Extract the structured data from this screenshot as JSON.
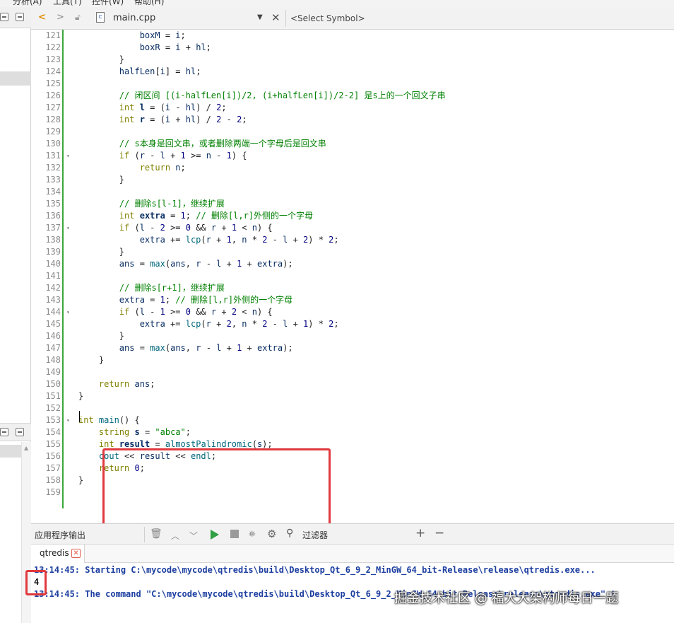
{
  "menu": {
    "items": [
      "分析(A)",
      "工具(T)",
      "控件(W)",
      "帮助(H)"
    ]
  },
  "editor_toolbar": {
    "file_name": "main.cpp",
    "symbol_select": "<Select Symbol>"
  },
  "code_lines": [
    {
      "n": "121",
      "fold": "",
      "t": "            boxM = i;"
    },
    {
      "n": "122",
      "fold": "",
      "t": "            boxR = i + hl;"
    },
    {
      "n": "123",
      "fold": "",
      "t": "        }"
    },
    {
      "n": "124",
      "fold": "",
      "t": "        halfLen[i] = hl;"
    },
    {
      "n": "125",
      "fold": "",
      "t": ""
    },
    {
      "n": "126",
      "fold": "",
      "t": "        // 闭区间 [(i-halfLen[i])/2, (i+halfLen[i])/2-2] 是s上的一个回文子串"
    },
    {
      "n": "127",
      "fold": "",
      "t": "        int l = (i - hl) / 2;"
    },
    {
      "n": "128",
      "fold": "",
      "t": "        int r = (i + hl) / 2 - 2;"
    },
    {
      "n": "129",
      "fold": "",
      "t": ""
    },
    {
      "n": "130",
      "fold": "",
      "t": "        // s本身是回文串，或者删除两端一个字母后是回文串"
    },
    {
      "n": "131",
      "fold": "▾",
      "t": "        if (r - l + 1 >= n - 1) {"
    },
    {
      "n": "132",
      "fold": "",
      "t": "            return n;"
    },
    {
      "n": "133",
      "fold": "",
      "t": "        }"
    },
    {
      "n": "134",
      "fold": "",
      "t": ""
    },
    {
      "n": "135",
      "fold": "",
      "t": "        // 删除s[l-1]，继续扩展"
    },
    {
      "n": "136",
      "fold": "",
      "t": "        int extra = 1; // 删除[l,r]外侧的一个字母"
    },
    {
      "n": "137",
      "fold": "▾",
      "t": "        if (l - 2 >= 0 && r + 1 < n) {"
    },
    {
      "n": "138",
      "fold": "",
      "t": "            extra += lcp(r + 1, n * 2 - l + 2) * 2;"
    },
    {
      "n": "139",
      "fold": "",
      "t": "        }"
    },
    {
      "n": "140",
      "fold": "",
      "t": "        ans = max(ans, r - l + 1 + extra);"
    },
    {
      "n": "141",
      "fold": "",
      "t": ""
    },
    {
      "n": "142",
      "fold": "",
      "t": "        // 删除s[r+1]，继续扩展"
    },
    {
      "n": "143",
      "fold": "",
      "t": "        extra = 1; // 删除[l,r]外侧的一个字母"
    },
    {
      "n": "144",
      "fold": "▾",
      "t": "        if (l - 1 >= 0 && r + 2 < n) {"
    },
    {
      "n": "145",
      "fold": "",
      "t": "            extra += lcp(r + 2, n * 2 - l + 1) * 2;"
    },
    {
      "n": "146",
      "fold": "",
      "t": "        }"
    },
    {
      "n": "147",
      "fold": "",
      "t": "        ans = max(ans, r - l + 1 + extra);"
    },
    {
      "n": "148",
      "fold": "",
      "t": "    }"
    },
    {
      "n": "149",
      "fold": "",
      "t": ""
    },
    {
      "n": "150",
      "fold": "",
      "t": "    return ans;"
    },
    {
      "n": "151",
      "fold": "",
      "t": "}"
    },
    {
      "n": "152",
      "fold": "",
      "t": ""
    },
    {
      "n": "153",
      "fold": "▾",
      "t": "int main() {"
    },
    {
      "n": "154",
      "fold": "",
      "t": "    string s = \"abca\";"
    },
    {
      "n": "155",
      "fold": "",
      "t": "    int result = almostPalindromic(s);"
    },
    {
      "n": "156",
      "fold": "",
      "t": "    cout << result << endl;"
    },
    {
      "n": "157",
      "fold": "",
      "t": "    return 0;"
    },
    {
      "n": "158",
      "fold": "",
      "t": "}"
    },
    {
      "n": "159",
      "fold": "",
      "t": ""
    }
  ],
  "output_pane": {
    "title": "应用程序输出",
    "filter_label": "过滤器",
    "tab_label": "qtredis",
    "lines": [
      {
        "kind": "info",
        "text": "13:14:45: Starting C:\\mycode\\mycode\\qtredis\\build\\Desktop_Qt_6_9_2_MinGW_64_bit-Release\\release\\qtredis.exe..."
      },
      {
        "kind": "plain",
        "text": "4"
      },
      {
        "kind": "info",
        "text": "13:14:45: The command \"C:\\mycode\\mycode\\qtredis\\build\\Desktop_Qt_6_9_2_MinGW_64_bit-Release\\release\\qtredis.exe\" t"
      }
    ]
  },
  "watermark": "掘金技术社区 @ 福大大架构师每日一题",
  "colors": {
    "change_bar": "#3aa83a",
    "highlight_box": "#e0393e",
    "keyword": "#808000",
    "comment": "#008000",
    "output_info": "#1c3ea0"
  }
}
